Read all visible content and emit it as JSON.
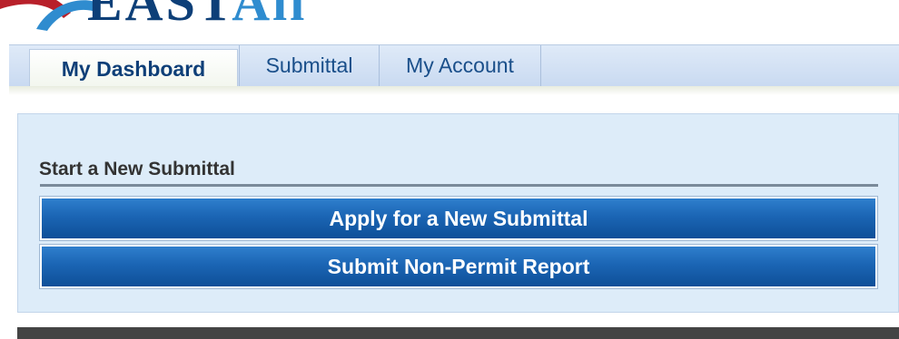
{
  "logo": {
    "text_part1": "EAST",
    "text_part2": "All",
    "colors": {
      "dark": "#0d3f78",
      "light": "#2f8ccf",
      "swoosh": "#b8202a"
    }
  },
  "tabs": [
    {
      "label": "My Dashboard",
      "active": true
    },
    {
      "label": "Submittal",
      "active": false
    },
    {
      "label": "My Account",
      "active": false
    }
  ],
  "panel": {
    "section_title": "Start a New Submittal",
    "buttons": [
      {
        "label": "Apply for a New Submittal"
      },
      {
        "label": "Submit Non-Permit Report"
      }
    ]
  },
  "colors": {
    "accent_button": "#1b65b4",
    "tab_text": "#1a4f8a",
    "panel_bg": "#ddecf9"
  }
}
